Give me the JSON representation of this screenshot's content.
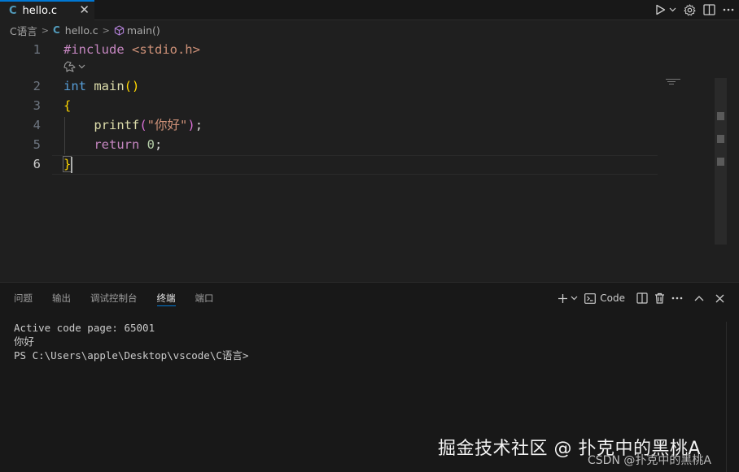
{
  "tab": {
    "icon_letter": "C",
    "filename": "hello.c",
    "close_glyph": "✕"
  },
  "breadcrumb": {
    "folder": "C语言",
    "file_icon_letter": "C",
    "file": "hello.c",
    "symbol": "main()"
  },
  "editor": {
    "line_numbers": [
      "1",
      "2",
      "3",
      "4",
      "5",
      "6"
    ],
    "active_line": "6",
    "lines": {
      "l1": {
        "directive": "#include",
        "header": " <stdio.h>"
      },
      "l2": {
        "type": "int",
        "name": " main",
        "parens": "()"
      },
      "l3": {
        "brace": "{"
      },
      "l4": {
        "indent": "    ",
        "fn": "printf",
        "open": "(",
        "str": "\"你好\"",
        "close": ")",
        "semi": ";"
      },
      "l5": {
        "indent": "    ",
        "kw": "return",
        "num": " 0",
        "semi": ";"
      },
      "l6": {
        "brace": "}"
      }
    }
  },
  "panel": {
    "tabs": [
      "问题",
      "输出",
      "调试控制台",
      "终端",
      "端口"
    ],
    "active_tab": "终端",
    "terminal_label": "Code",
    "add_glyph": "+",
    "more_glyph": "···"
  },
  "terminal": {
    "lines": [
      "Active code page: 65001",
      "你好",
      "PS C:\\Users\\apple\\Desktop\\vscode\\C语言>"
    ]
  },
  "watermark": {
    "main": "掘金技术社区 @ 扑克中的黑桃A",
    "csdn": "CSDN @扑克中的黑桃A"
  },
  "colors": {
    "accent": "#0078d4",
    "editor_bg": "#1f1f1f",
    "panel_bg": "#181818",
    "keyword": "#c586c0",
    "string": "#ce9178",
    "type": "#569cd6",
    "function": "#dcdcaa",
    "number": "#b5cea8",
    "bracket": "#ffd700"
  }
}
